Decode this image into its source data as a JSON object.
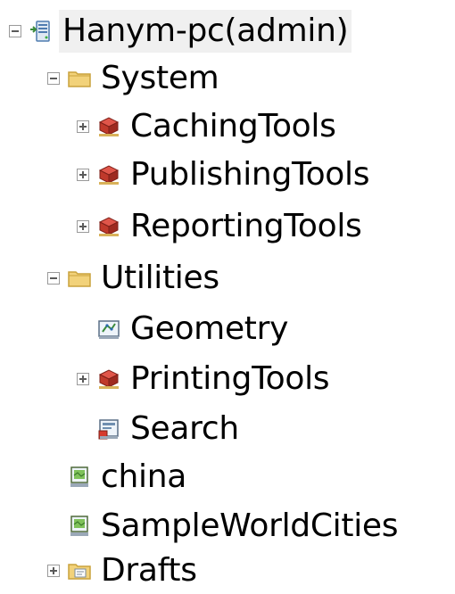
{
  "tree": {
    "root": {
      "label": "Hanym-pc(admin)",
      "icon": "server-connection-icon",
      "expanded": true,
      "selected": true
    },
    "system": {
      "label": "System",
      "icon": "folder-icon",
      "expanded": true,
      "children": [
        {
          "label": "CachingTools",
          "icon": "gp-service-icon",
          "expanded": false
        },
        {
          "label": "PublishingTools",
          "icon": "gp-service-icon",
          "expanded": false
        },
        {
          "label": "ReportingTools",
          "icon": "gp-service-icon",
          "expanded": false
        }
      ]
    },
    "utilities": {
      "label": "Utilities",
      "icon": "folder-icon",
      "expanded": true,
      "children": [
        {
          "label": "Geometry",
          "icon": "geometry-service-icon"
        },
        {
          "label": "PrintingTools",
          "icon": "gp-service-icon",
          "expanded": false
        },
        {
          "label": "Search",
          "icon": "search-service-icon"
        }
      ]
    },
    "services": [
      {
        "label": "china",
        "icon": "map-service-icon"
      },
      {
        "label": "SampleWorldCities",
        "icon": "map-service-icon"
      }
    ],
    "drafts": {
      "label": "Drafts",
      "icon": "drafts-folder-icon",
      "expanded": false
    }
  },
  "colors": {
    "folder": "#f2d27a",
    "folder_border": "#c9a23c",
    "gp_red": "#c0392b",
    "gp_dark": "#7d1f17",
    "selection": "#f0f0f0"
  }
}
